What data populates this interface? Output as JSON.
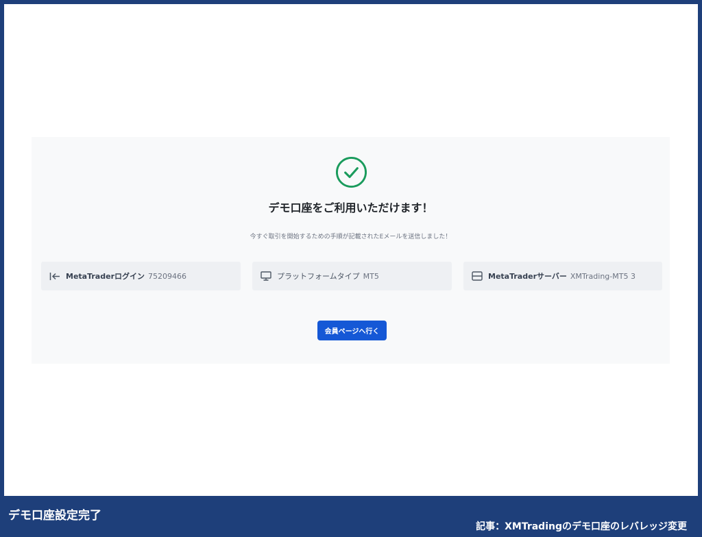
{
  "dialog": {
    "status_icon": "check-circle-icon",
    "title": "デモ口座をご利用いただけます！",
    "subtitle": "今すぐ取引を開始するための手順が記載されたEメールを送信しました！",
    "info": [
      {
        "icon": "login-arrow-icon",
        "label": "MetaTraderログイン",
        "value": "75209466"
      },
      {
        "icon": "monitor-icon",
        "label": "プラットフォームタイプ",
        "value": "MT5"
      },
      {
        "icon": "server-icon",
        "label": "MetaTraderサーバー",
        "value": "XMTrading-MT5 3"
      }
    ],
    "button_label": "会員ページへ行く"
  },
  "colors": {
    "success": "#1a9b5c",
    "primary_button": "#1558d6",
    "frame": "#1e3f7a"
  },
  "caption": {
    "left": "デモ口座設定完了",
    "right": "記事：XMTradingのデモ口座のレバレッジ変更"
  }
}
